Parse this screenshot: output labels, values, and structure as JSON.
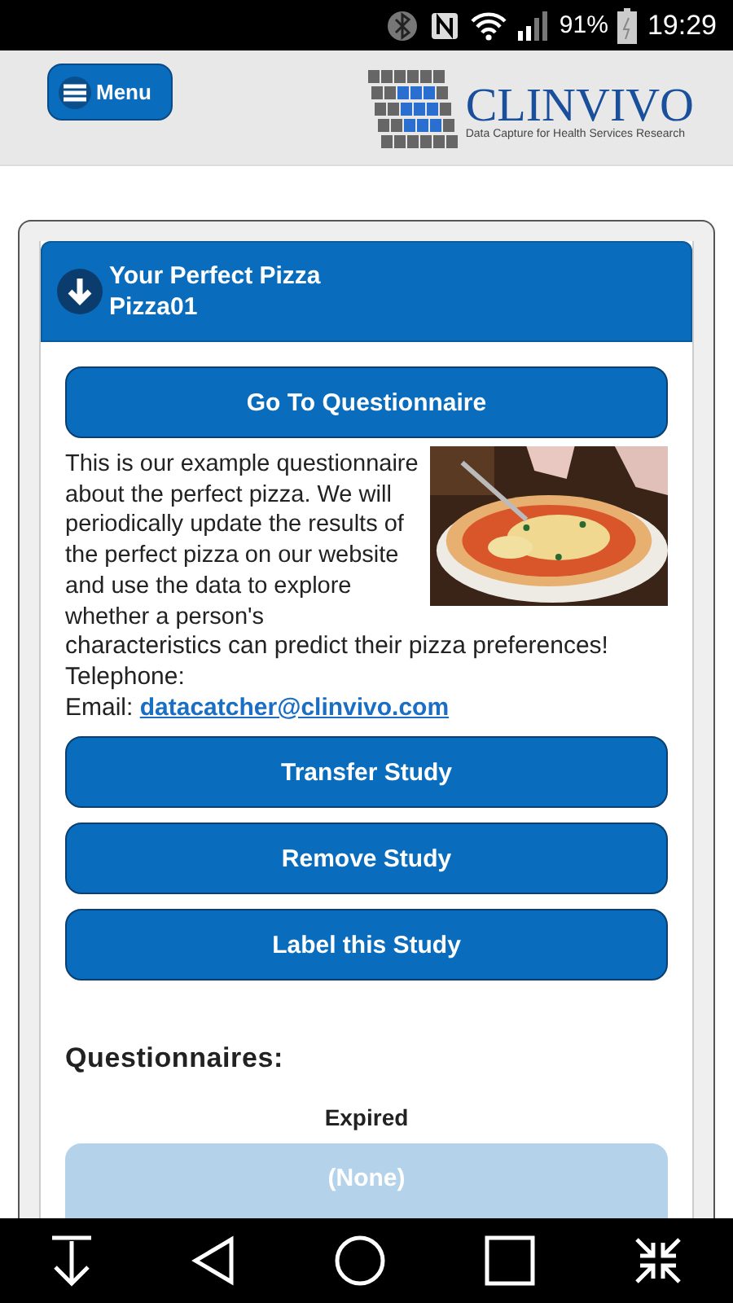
{
  "status_bar": {
    "battery": "91%",
    "time": "19:29"
  },
  "header": {
    "menu_button": "Menu",
    "logo": {
      "name": "CLINVIVO",
      "tagline": "Data Capture for Health Services Research"
    }
  },
  "study": {
    "title": "Your Perfect Pizza",
    "code": "Pizza01",
    "open_button": "Go To Questionnaire",
    "description_parts": [
      "This is our example questionnaire about the perfect pizza. We will periodically update the results of the perfect pizza on our website and use the data to explore whether a person's",
      "characteristics can predict their pizza preferences!"
    ],
    "telephone_label": "Telephone:",
    "email_label": "Email:",
    "email": "datacatcher@clinvivo.com",
    "actions": [
      "Transfer Study",
      "Remove Study",
      "Label this Study"
    ],
    "questionnaires_heading": "Questionnaires:",
    "expired_label": "Expired",
    "expired_items": [
      {
        "label": "(None)",
        "disabled": true
      }
    ]
  }
}
